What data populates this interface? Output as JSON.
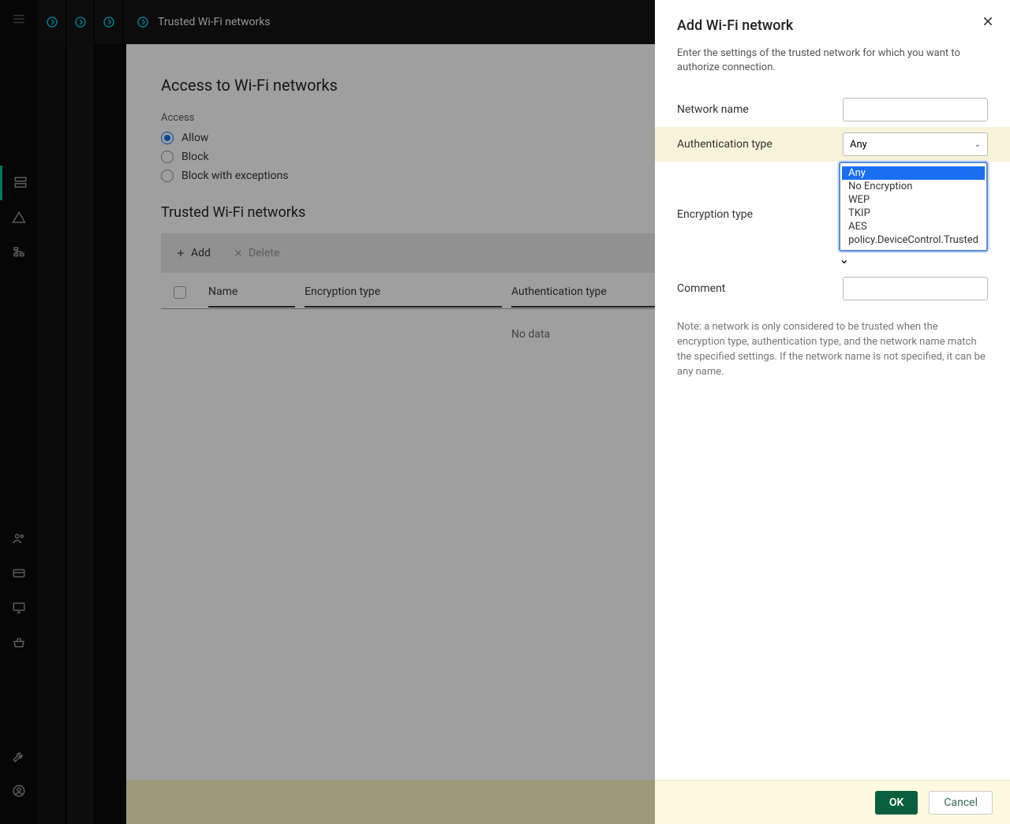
{
  "breadcrumb": {
    "title": "Trusted Wi-Fi networks"
  },
  "main": {
    "heading_access": "Access to Wi-Fi networks",
    "label_access": "Access",
    "radios": {
      "allow": "Allow",
      "block": "Block",
      "block_exceptions": "Block with exceptions"
    },
    "heading_trusted": "Trusted Wi-Fi networks",
    "toolbar": {
      "add": "Add",
      "delete": "Delete"
    },
    "table": {
      "col_name": "Name",
      "col_encryption": "Encryption type",
      "col_auth": "Authentication type",
      "no_data": "No data"
    }
  },
  "panel": {
    "title": "Add Wi-Fi network",
    "subtitle": "Enter the settings of the trusted network for which you want to authorize connection.",
    "rows": {
      "network_name": "Network name",
      "auth_type": "Authentication type",
      "encryption_type": "Encryption type",
      "comment": "Comment"
    },
    "auth_select_value": "Any",
    "encryption_options": [
      "Any",
      "No Encryption",
      "WEP",
      "TKIP",
      "AES",
      "policy.DeviceControl.Trusted"
    ],
    "encryption_selected_index": 0,
    "note": "Note: a network is only considered to be trusted when the encryption type, authentication type, and the network name match the specified settings. If the network name is not specified, it can be any name.",
    "buttons": {
      "ok": "OK",
      "cancel": "Cancel"
    }
  }
}
